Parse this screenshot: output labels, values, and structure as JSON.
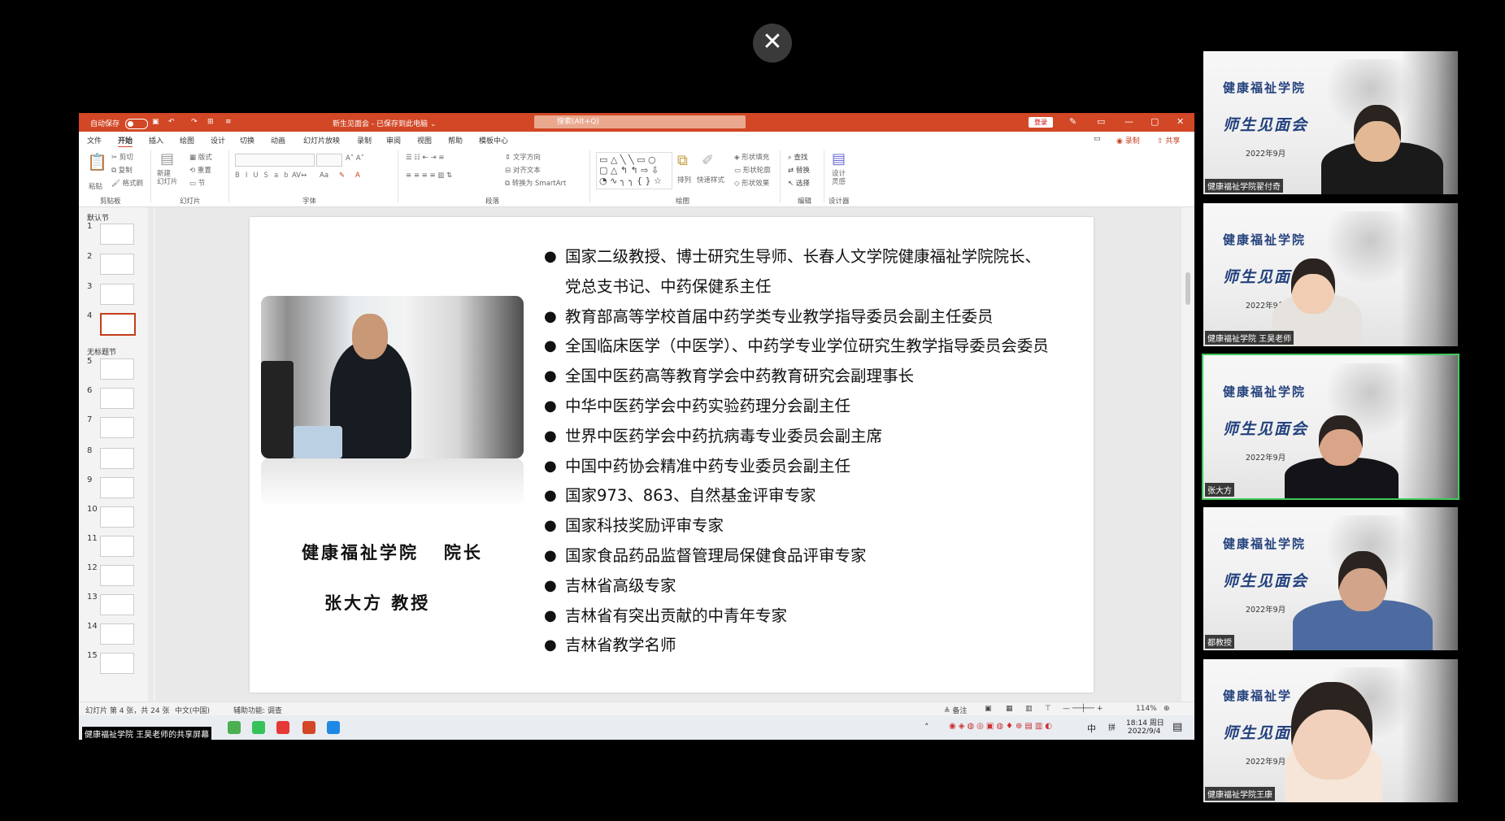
{
  "close_button": {
    "glyph": "✕"
  },
  "ppt": {
    "title": {
      "autosave_label": "自动保存",
      "toggle_state": "关",
      "doc_title": "新生见面会 - 已保存到此电脑 ⌄",
      "search_placeholder": "搜索(Alt+Q)",
      "login_label": "登录"
    },
    "menu": [
      "文件",
      "开始",
      "插入",
      "绘图",
      "设计",
      "切换",
      "动画",
      "幻灯片放映",
      "录制",
      "审阅",
      "视图",
      "帮助",
      "模板中心"
    ],
    "menu_right": {
      "comment": "▭",
      "record": "◉ 录制",
      "share": "⇧ 共享"
    },
    "ribbon": {
      "groups": [
        "剪贴板",
        "幻灯片",
        "字体",
        "段落",
        "绘图",
        "编辑",
        "设计器"
      ],
      "clipboard": {
        "paste": "粘贴",
        "cut": "剪切",
        "copy": "复制",
        "format_painter": "格式刷"
      },
      "slides": {
        "new_slide": "新建\n幻灯片",
        "layout": "版式",
        "reset": "重置",
        "section": "节"
      },
      "editing": {
        "find": "查找",
        "replace": "替换",
        "select": "选择"
      },
      "designer": {
        "label": "设计\n灵感"
      },
      "drawing": {
        "arrange": "排列",
        "quick_styles": "快速样式",
        "fill": "形状填充",
        "outline": "形状轮廓",
        "effects": "形状效果"
      },
      "paragraph": {
        "text_direction": "文字方向",
        "align_text": "对齐文本",
        "smartart": "转换为 SmartArt"
      }
    },
    "thumbnails": {
      "section_default": "默认节",
      "section_untitled": "无标题节",
      "numbers": [
        "1",
        "2",
        "3",
        "4",
        "5",
        "6",
        "7",
        "8",
        "9",
        "10",
        "11",
        "12",
        "13",
        "14",
        "15"
      ],
      "selected_index": 4
    },
    "slide": {
      "caption_line1": "健康福祉学院   院长",
      "caption_line2": "张大方 教授",
      "bullet_glyph": "●",
      "bullets": [
        "国家二级教授、博士研究生导师、长春人文学院健康福祉学院院长、",
        "党总支书记、中药保健系主任",
        "教育部高等学校首届中药学类专业教学指导委员会副主任委员",
        "全国临床医学（中医学）、中药学专业学位研究生教学指导委员会委员",
        "全国中医药高等教育学会中药教育研究会副理事长",
        "中华中医药学会中药实验药理分会副主任",
        "世界中医药学会中药抗病毒专业委员会副主席",
        "中国中药协会精准中药专业委员会副主任",
        "国家973、863、自然基金评审专家",
        "国家科技奖励评审专家",
        "国家食品药品监督管理局保健食品评审专家",
        "吉林省高级专家",
        "吉林省有突出贡献的中青年专家",
        "吉林省教学名师"
      ],
      "bullet_continuation": [
        false,
        true,
        false,
        false,
        false,
        false,
        false,
        false,
        false,
        false,
        false,
        false,
        false,
        false
      ]
    },
    "status": {
      "slide_info": "幻灯片 第 4 张，共 24 张",
      "language": "中文(中国)",
      "accessibility": "辅助功能: 调查",
      "notes": "≜ 备注",
      "zoom": "114%"
    },
    "taskbar": {
      "share_label": "健康福祉学院 王昊老师的共享屏幕",
      "time": "18:14 周日",
      "date": "2022/9/4",
      "ime": "中",
      "ime2": "拼"
    }
  },
  "participants": [
    {
      "name": "健康福祉学院翟付奇",
      "active": false,
      "school": "健康福祉学院",
      "meeting": "师生见面会",
      "date": "2022年9月"
    },
    {
      "name": "健康福祉学院 王昊老师",
      "active": false,
      "school": "健康福祉学院",
      "meeting": "师生见面会",
      "date": "2022年9月"
    },
    {
      "name": "张大方",
      "active": true,
      "school": "健康福祉学院",
      "meeting": "师生见面会",
      "date": "2022年9月"
    },
    {
      "name": "都教授",
      "active": false,
      "school": "健康福祉学院",
      "meeting": "师生见面会",
      "date": "2022年9月"
    },
    {
      "name": "健康福祉学院王康",
      "active": false,
      "school": "健康福祉学",
      "meeting": "师生见面",
      "date": "2022年9月"
    }
  ],
  "colors": {
    "ppt_accent": "#d24726",
    "tile_title": "#23417e",
    "active_speaker": "#3fca5a"
  }
}
